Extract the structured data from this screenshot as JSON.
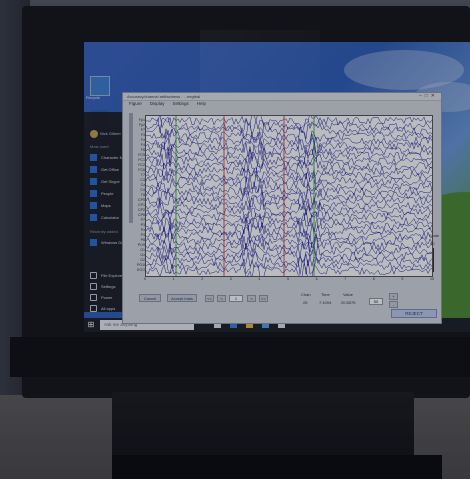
{
  "desktop": {
    "icon_label": "Recycle"
  },
  "start_menu": {
    "user_name": "Nick Gilbert",
    "section_most_used": "Most used",
    "items": [
      {
        "label": "Character Map"
      },
      {
        "label": "Get Office"
      },
      {
        "label": "Get Skype"
      },
      {
        "label": "People"
      },
      {
        "label": "Maps"
      },
      {
        "label": "Calculator"
      }
    ],
    "section_recent": "Recently added",
    "recent_item": "Windows Defender",
    "bottom_items": [
      {
        "label": "File Explorer"
      },
      {
        "label": "Settings"
      },
      {
        "label": "Power"
      },
      {
        "label": "All apps"
      }
    ]
  },
  "taskbar": {
    "search_placeholder": "Ask me anything"
  },
  "eeg_window": {
    "title": "Accuracy/channel artifactness - ...eegtrial",
    "menu": [
      "Figure",
      "Display",
      "Settings",
      "Help"
    ],
    "channels": [
      "Fp1",
      "Fp2",
      "F7",
      "F3",
      "Fz",
      "F4",
      "F8",
      "FC5",
      "FC1",
      "FC2",
      "FC6",
      "T7",
      "C3",
      "Cz",
      "C4",
      "T8",
      "CP5",
      "CP1",
      "CP2",
      "CP6",
      "P7",
      "P3",
      "Pz",
      "P4",
      "P8",
      "PO9",
      "O1",
      "Oz",
      "O2",
      "PO10",
      "EOG"
    ],
    "time_ticks": [
      "0",
      "1",
      "2",
      "3",
      "4",
      "5",
      "6",
      "7",
      "8",
      "9",
      "10"
    ],
    "scale_label": "Scale",
    "scale_value": "50",
    "buttons": {
      "cancel": "Cancel",
      "reject": "Reject",
      "reject_final": "REJECT",
      "accept": "Accept trials"
    },
    "nav": [
      "<<",
      "<",
      "1",
      ">",
      ">>"
    ],
    "info": {
      "chan_label": "Chan",
      "chan_value": "25",
      "time_label": "Time",
      "time_value": "7.1094",
      "value_label": "Value",
      "value_value": "20.8575"
    },
    "field_value": "50"
  }
}
